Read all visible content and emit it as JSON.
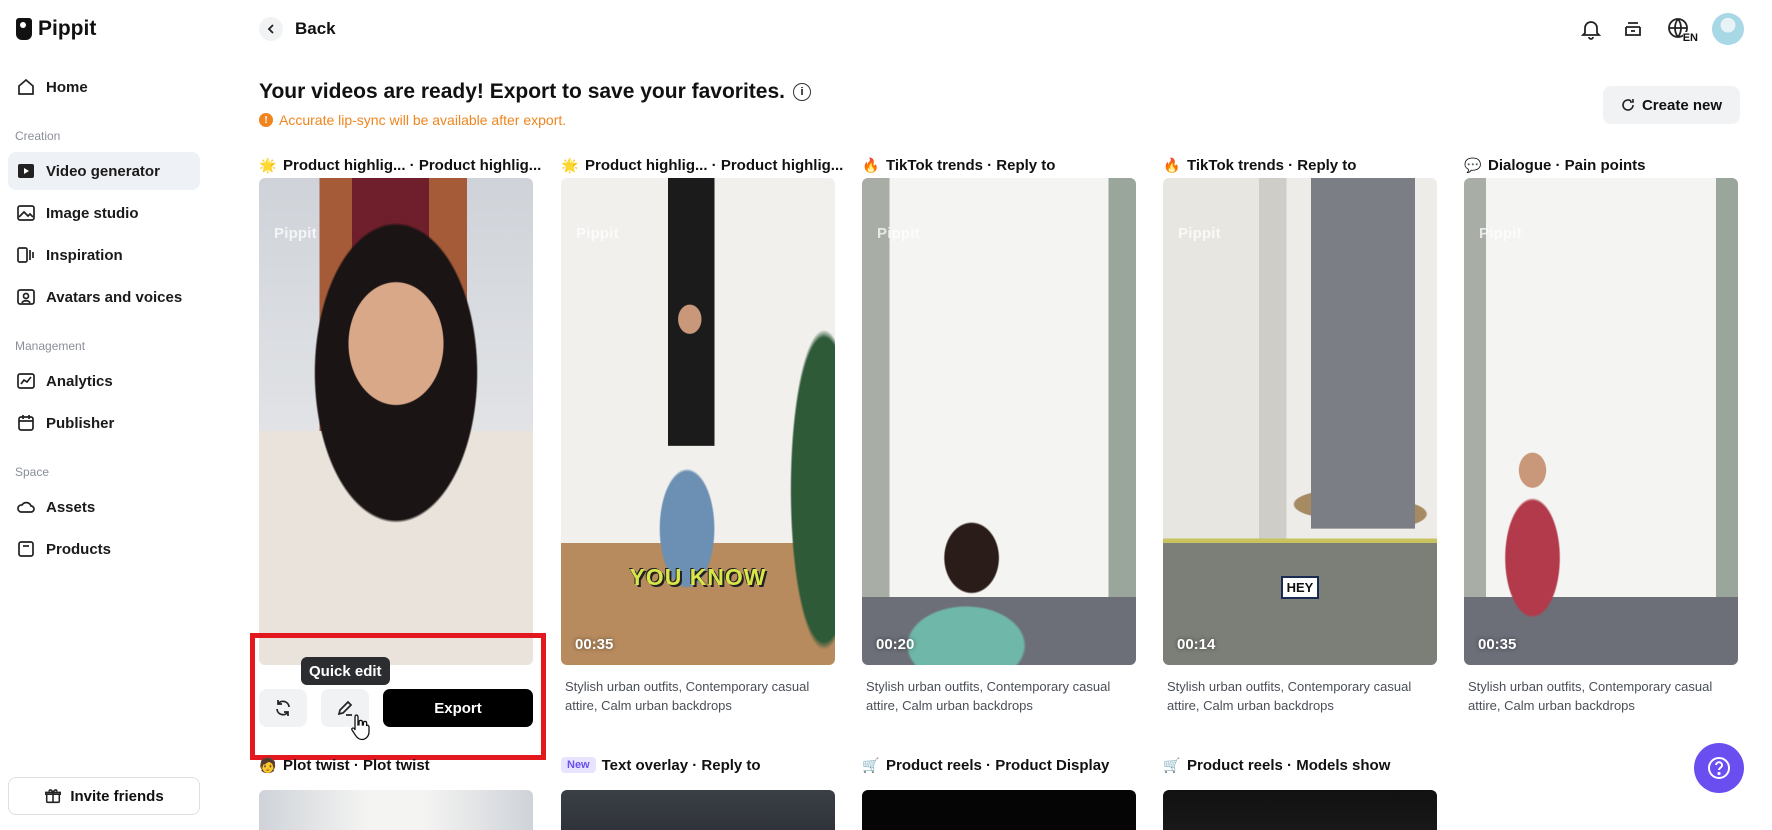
{
  "app": {
    "name": "Pippit"
  },
  "sidebar": {
    "home": "Home",
    "sections": [
      "Creation",
      "Management",
      "Space"
    ],
    "creation": [
      "Video generator",
      "Image studio",
      "Inspiration",
      "Avatars and voices"
    ],
    "management": [
      "Analytics",
      "Publisher"
    ],
    "space": [
      "Assets",
      "Products"
    ],
    "invite": "Invite friends",
    "active": "Video generator"
  },
  "header": {
    "back": "Back",
    "lang": "EN",
    "title": "Your videos are ready! Export to save your favorites.",
    "warning": "Accurate lip-sync will be available after export.",
    "create_new": "Create new"
  },
  "cards": [
    {
      "label": "Product highlig... · Product highlig...",
      "icon": "sparkle-icon",
      "watermark": "Pippit",
      "duration": "",
      "caption": "",
      "description": ""
    },
    {
      "label": "Product highlig... · Product highlig...",
      "icon": "sparkle-icon",
      "watermark": "Pippit",
      "duration": "00:35",
      "caption": "YOU KNOW",
      "description": "Stylish urban outfits, Contemporary casual attire, Calm urban backdrops"
    },
    {
      "label": "TikTok trends · Reply to",
      "icon": "fire-icon",
      "watermark": "Pippit",
      "duration": "00:20",
      "caption": "",
      "description": "Stylish urban outfits, Contemporary casual attire, Calm urban backdrops"
    },
    {
      "label": "TikTok trends · Reply to",
      "icon": "fire-icon",
      "watermark": "Pippit",
      "duration": "00:14",
      "caption": "HEY",
      "description": "Stylish urban outfits, Contemporary casual attire, Calm urban backdrops"
    },
    {
      "label": "Dialogue · Pain points",
      "icon": "chat-icon",
      "watermark": "Pippit",
      "duration": "00:35",
      "caption": "",
      "description": "Stylish urban outfits, Contemporary casual attire, Calm urban backdrops"
    }
  ],
  "card_actions": {
    "tooltip": "Quick edit",
    "export": "Export"
  },
  "bottom_cards": [
    {
      "label": "Plot twist · Plot twist",
      "icon": "person-icon"
    },
    {
      "label": "Text overlay · Reply to",
      "badge": "New"
    },
    {
      "label": "Product reels · Product Display",
      "icon": "cart-icon"
    },
    {
      "label": "Product reels · Models show",
      "icon": "cart-icon"
    }
  ],
  "colors": {
    "accent": "#6a4ef0",
    "warning": "#f0851f",
    "highlight": "#e3181f"
  }
}
